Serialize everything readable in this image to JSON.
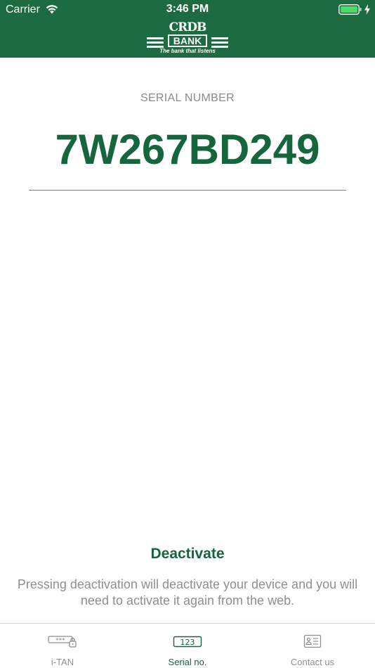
{
  "status_bar": {
    "carrier": "Carrier",
    "time": "3:46 PM"
  },
  "header": {
    "logo_top": "CRDB",
    "logo_bank": "BANK",
    "logo_tagline": "The bank that listens",
    "background_color": "#1d6b40"
  },
  "main": {
    "serial_label": "SERIAL NUMBER",
    "serial_value": "7W267BD249",
    "accent_color": "#15653d"
  },
  "deactivate": {
    "button_label": "Deactivate",
    "note": "Pressing deactivation will deactivate your device and you will need to activate it again from the web."
  },
  "tab_bar": {
    "tabs": [
      {
        "label": "i-TAN",
        "icon": "password-lock-icon",
        "active": false
      },
      {
        "label": "Serial no.",
        "icon": "number-123-icon",
        "active": true
      },
      {
        "label": "Contact us",
        "icon": "contact-card-icon",
        "active": false
      }
    ]
  }
}
